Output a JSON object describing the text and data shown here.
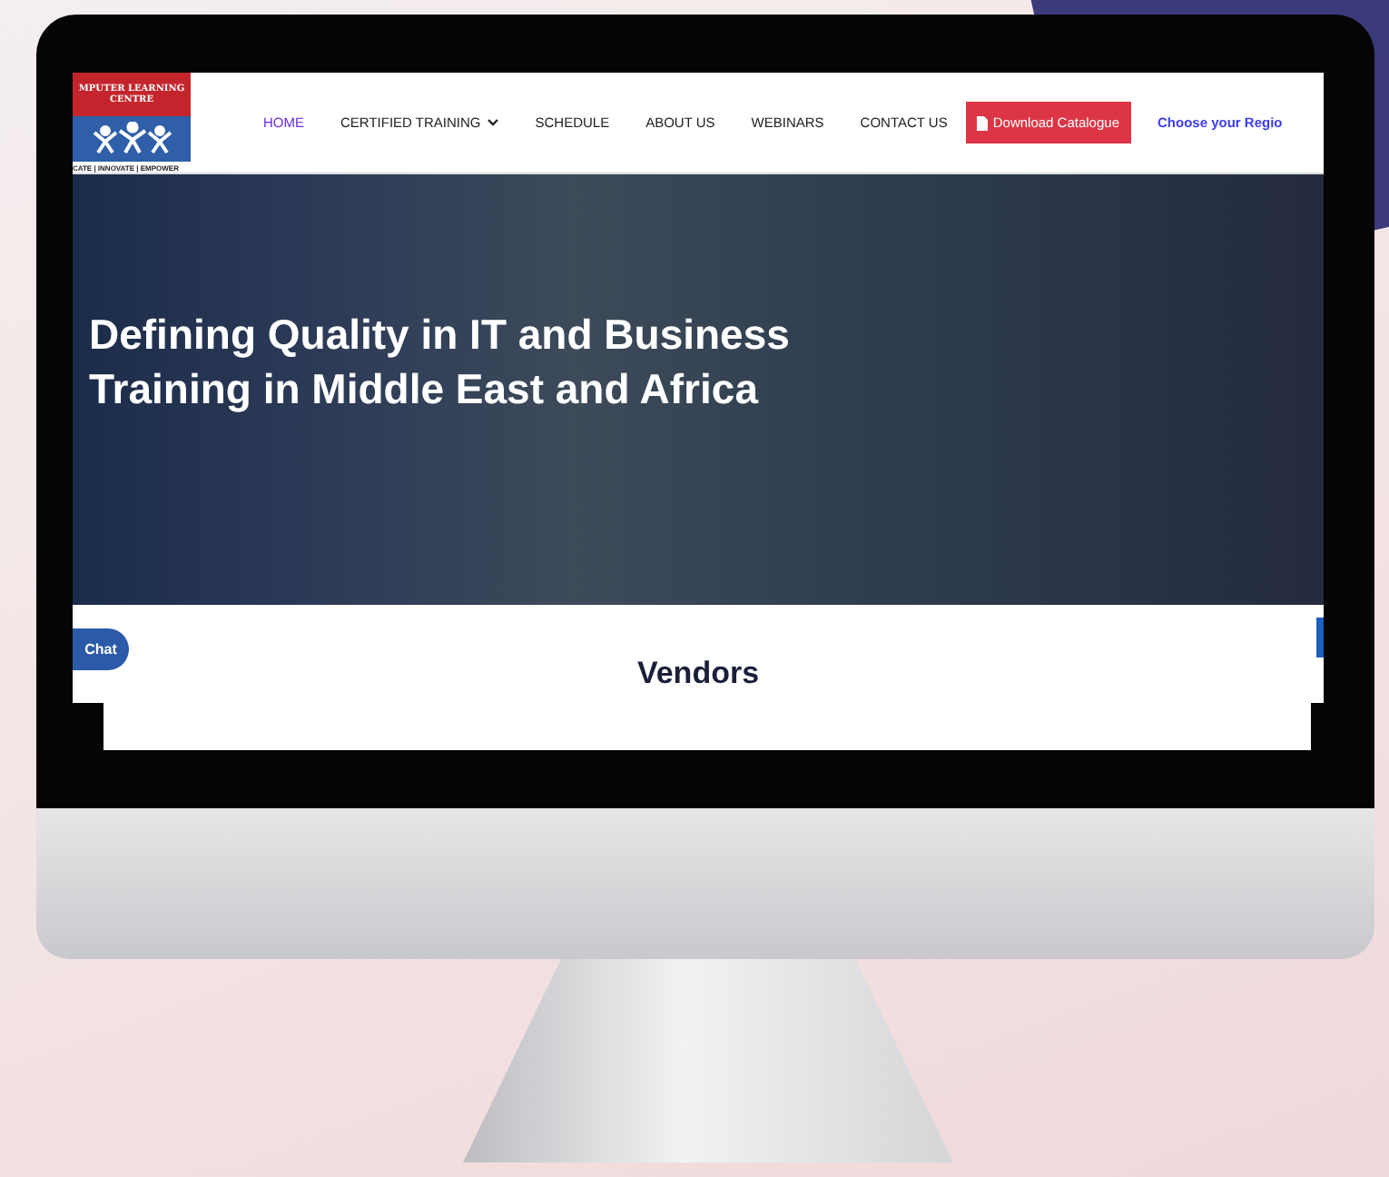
{
  "logo": {
    "lines": [
      "MPUTER LEARNING",
      "CENTRE"
    ],
    "tagline": "CATE | INNOVATE | EMPOWER"
  },
  "nav": [
    {
      "label": "HOME",
      "selected": true,
      "dropdown": false
    },
    {
      "label": "CERTIFIED TRAINING",
      "selected": false,
      "dropdown": true
    },
    {
      "label": "SCHEDULE",
      "selected": false,
      "dropdown": false
    },
    {
      "label": "ABOUT US",
      "selected": false,
      "dropdown": false
    },
    {
      "label": "WEBINARS",
      "selected": false,
      "dropdown": false
    },
    {
      "label": "CONTACT US",
      "selected": false,
      "dropdown": false
    }
  ],
  "download_button": "Download Catalogue",
  "region_link": "Choose your Regio",
  "hero": {
    "heading": "Defining Quality in IT and Business Training in Middle East and Africa"
  },
  "chat_button": "Chat",
  "section_title": "Vendors"
}
